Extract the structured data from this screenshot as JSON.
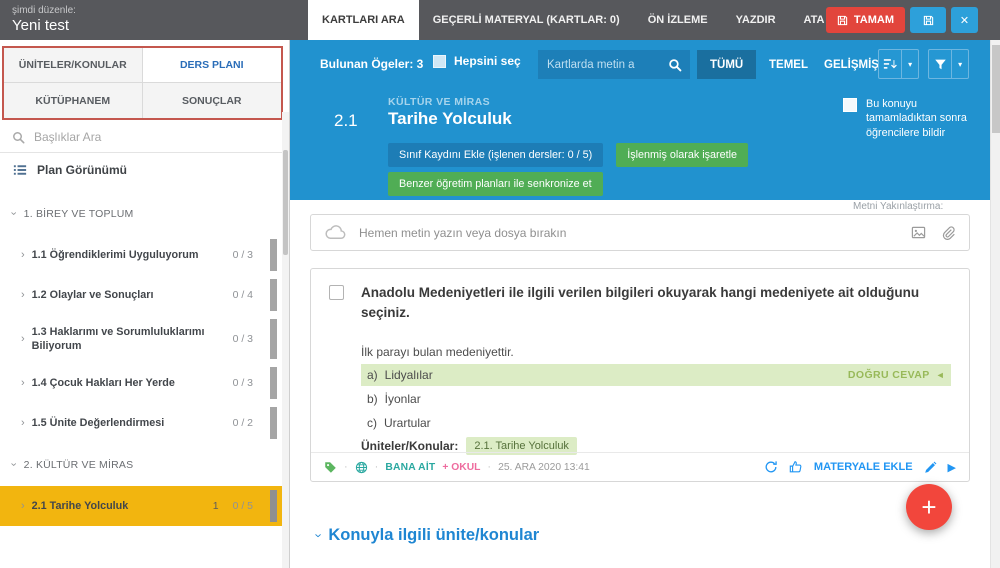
{
  "glyphs": {
    "close": "✕",
    "chevron": "›",
    "dropdown": "▾",
    "play": "▶",
    "dot": "·",
    "correct_arrow": "◄",
    "plus": "+"
  },
  "colors": {
    "topbar_bg": "#57585c",
    "accent_blue": "#2192cf",
    "dark_blue_button": "#1d7db6",
    "active_filter_blue": "#1a6f9f",
    "green_button": "#50ad55",
    "red_button": "#e2453c",
    "blue_button": "#2da0da",
    "selected_topic_yellow": "#f2b50f",
    "correct_answer_bg": "#dcecc5",
    "correct_answer_text": "#98b959",
    "link_blue": "#2196f3",
    "owner_teal": "#2aa8a0",
    "school_pink": "#ee6b9e",
    "fab_red": "#f2463c",
    "tab_outline_red": "#c4574e"
  },
  "topbar": {
    "editing_label": "şimdi düzenle:",
    "title": "Yeni test",
    "tabs": [
      {
        "label": "KARTLARI ARA",
        "active": true
      },
      {
        "label": "GEÇERLİ MATERYAL (KARTLAR: 0)",
        "active": false
      },
      {
        "label": "ÖN İZLEME",
        "active": false
      },
      {
        "label": "YAZDIR",
        "active": false
      },
      {
        "label": "ATA",
        "active": false
      }
    ],
    "confirm_label": "TAMAM"
  },
  "sidebar": {
    "tabs": [
      {
        "label": "ÜNİTELER/KONULAR",
        "active": false
      },
      {
        "label": "DERS PLANI",
        "active": true
      },
      {
        "label": "KÜTÜPHANEM",
        "active": false
      },
      {
        "label": "SONUÇLAR",
        "active": false
      }
    ],
    "search_placeholder": "Başlıklar Ara",
    "plan_view_label": "Plan Görünümü",
    "tree": [
      {
        "type": "unit",
        "label": "1. BİREY VE TOPLUM"
      },
      {
        "type": "topic",
        "label": "1.1 Öğrendiklerimi Uyguluyorum",
        "count": "0 / 3"
      },
      {
        "type": "topic",
        "label": "1.2 Olaylar ve Sonuçları",
        "count": "0 / 4"
      },
      {
        "type": "topic",
        "label": "1.3 Haklarımı ve Sorumluluklarımı Biliyorum",
        "count": "0 / 3"
      },
      {
        "type": "topic",
        "label": "1.4 Çocuk Hakları Her Yerde",
        "count": "0 / 3"
      },
      {
        "type": "topic",
        "label": "1.5 Ünite Değerlendirmesi",
        "count": "0 / 2"
      },
      {
        "type": "unit",
        "label": "2. KÜLTÜR VE MİRAS"
      },
      {
        "type": "topic",
        "label": "2.1 Tarihe Yolculuk",
        "badge": "1",
        "count": "0 / 5",
        "selected": true
      }
    ]
  },
  "toolbar": {
    "found_items": "Bulunan Ögeler: 3",
    "select_all_label": "Hepsini seç",
    "search_placeholder": "Kartlarda metin a",
    "filters": [
      {
        "label": "TÜMÜ",
        "active": true
      },
      {
        "label": "TEMEL",
        "active": false
      },
      {
        "label": "GELİŞMİŞ",
        "active": false
      }
    ]
  },
  "topic_header": {
    "unit_name": "KÜLTÜR VE MİRAS",
    "number": "2.1",
    "title": "Tarihe Yolculuk",
    "buttons": {
      "add_class_record": "Sınıf Kaydını Ekle (işlenen dersler: 0 / 5)",
      "mark_processed": "İşlenmiş olarak işaretle",
      "sync_similar": "Benzer öğretim planları ile senkronize et"
    },
    "notify_label": "Bu konuyu tamamladıktan sonra öğrencilere bildir"
  },
  "content": {
    "zoom_label": "Metni Yakınlaştırma:",
    "dropzone_text": "Hemen metin yazın veya dosya bırakın",
    "card": {
      "question": "Anadolu Medeniyetleri ile ilgili verilen bilgileri okuyarak hangi medeniyete ait olduğunu seçiniz.",
      "stem": "İlk parayı bulan medeniyettir.",
      "options": [
        {
          "key": "a)",
          "text": "Lidyalılar",
          "correct": true,
          "correct_label": "DOĞRU CEVAP"
        },
        {
          "key": "b)",
          "text": "İyonlar",
          "correct": false
        },
        {
          "key": "c)",
          "text": "Urartular",
          "correct": false
        }
      ],
      "units_label": "Üniteler/Konular:",
      "unit_chip": "2.1. Tarihe Yolculuk",
      "meta": {
        "owner": "BANA AİT",
        "school": "+ OKUL",
        "date": "25. ARA 2020 13:41"
      },
      "add_to_material_label": "MATERYALE EKLE"
    },
    "related_heading": "Konuyla ilgili ünite/konular"
  }
}
